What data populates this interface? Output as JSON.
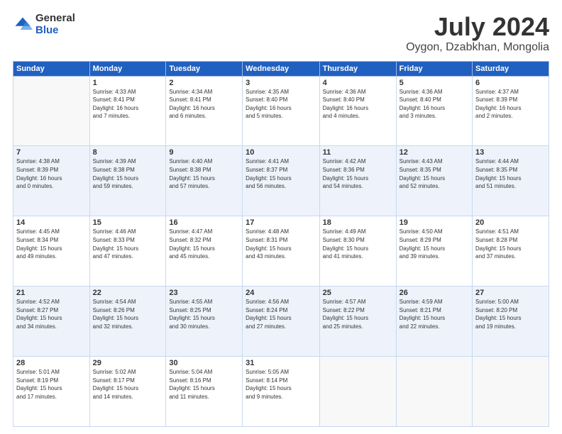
{
  "logo": {
    "general": "General",
    "blue": "Blue"
  },
  "header": {
    "month": "July 2024",
    "location": "Oygon, Dzabkhan, Mongolia"
  },
  "weekdays": [
    "Sunday",
    "Monday",
    "Tuesday",
    "Wednesday",
    "Thursday",
    "Friday",
    "Saturday"
  ],
  "weeks": [
    [
      {
        "day": "",
        "info": ""
      },
      {
        "day": "1",
        "info": "Sunrise: 4:33 AM\nSunset: 8:41 PM\nDaylight: 16 hours\nand 7 minutes."
      },
      {
        "day": "2",
        "info": "Sunrise: 4:34 AM\nSunset: 8:41 PM\nDaylight: 16 hours\nand 6 minutes."
      },
      {
        "day": "3",
        "info": "Sunrise: 4:35 AM\nSunset: 8:40 PM\nDaylight: 16 hours\nand 5 minutes."
      },
      {
        "day": "4",
        "info": "Sunrise: 4:36 AM\nSunset: 8:40 PM\nDaylight: 16 hours\nand 4 minutes."
      },
      {
        "day": "5",
        "info": "Sunrise: 4:36 AM\nSunset: 8:40 PM\nDaylight: 16 hours\nand 3 minutes."
      },
      {
        "day": "6",
        "info": "Sunrise: 4:37 AM\nSunset: 8:39 PM\nDaylight: 16 hours\nand 2 minutes."
      }
    ],
    [
      {
        "day": "7",
        "info": "Sunrise: 4:38 AM\nSunset: 8:39 PM\nDaylight: 16 hours\nand 0 minutes."
      },
      {
        "day": "8",
        "info": "Sunrise: 4:39 AM\nSunset: 8:38 PM\nDaylight: 15 hours\nand 59 minutes."
      },
      {
        "day": "9",
        "info": "Sunrise: 4:40 AM\nSunset: 8:38 PM\nDaylight: 15 hours\nand 57 minutes."
      },
      {
        "day": "10",
        "info": "Sunrise: 4:41 AM\nSunset: 8:37 PM\nDaylight: 15 hours\nand 56 minutes."
      },
      {
        "day": "11",
        "info": "Sunrise: 4:42 AM\nSunset: 8:36 PM\nDaylight: 15 hours\nand 54 minutes."
      },
      {
        "day": "12",
        "info": "Sunrise: 4:43 AM\nSunset: 8:35 PM\nDaylight: 15 hours\nand 52 minutes."
      },
      {
        "day": "13",
        "info": "Sunrise: 4:44 AM\nSunset: 8:35 PM\nDaylight: 15 hours\nand 51 minutes."
      }
    ],
    [
      {
        "day": "14",
        "info": "Sunrise: 4:45 AM\nSunset: 8:34 PM\nDaylight: 15 hours\nand 49 minutes."
      },
      {
        "day": "15",
        "info": "Sunrise: 4:46 AM\nSunset: 8:33 PM\nDaylight: 15 hours\nand 47 minutes."
      },
      {
        "day": "16",
        "info": "Sunrise: 4:47 AM\nSunset: 8:32 PM\nDaylight: 15 hours\nand 45 minutes."
      },
      {
        "day": "17",
        "info": "Sunrise: 4:48 AM\nSunset: 8:31 PM\nDaylight: 15 hours\nand 43 minutes."
      },
      {
        "day": "18",
        "info": "Sunrise: 4:49 AM\nSunset: 8:30 PM\nDaylight: 15 hours\nand 41 minutes."
      },
      {
        "day": "19",
        "info": "Sunrise: 4:50 AM\nSunset: 8:29 PM\nDaylight: 15 hours\nand 39 minutes."
      },
      {
        "day": "20",
        "info": "Sunrise: 4:51 AM\nSunset: 8:28 PM\nDaylight: 15 hours\nand 37 minutes."
      }
    ],
    [
      {
        "day": "21",
        "info": "Sunrise: 4:52 AM\nSunset: 8:27 PM\nDaylight: 15 hours\nand 34 minutes."
      },
      {
        "day": "22",
        "info": "Sunrise: 4:54 AM\nSunset: 8:26 PM\nDaylight: 15 hours\nand 32 minutes."
      },
      {
        "day": "23",
        "info": "Sunrise: 4:55 AM\nSunset: 8:25 PM\nDaylight: 15 hours\nand 30 minutes."
      },
      {
        "day": "24",
        "info": "Sunrise: 4:56 AM\nSunset: 8:24 PM\nDaylight: 15 hours\nand 27 minutes."
      },
      {
        "day": "25",
        "info": "Sunrise: 4:57 AM\nSunset: 8:22 PM\nDaylight: 15 hours\nand 25 minutes."
      },
      {
        "day": "26",
        "info": "Sunrise: 4:59 AM\nSunset: 8:21 PM\nDaylight: 15 hours\nand 22 minutes."
      },
      {
        "day": "27",
        "info": "Sunrise: 5:00 AM\nSunset: 8:20 PM\nDaylight: 15 hours\nand 19 minutes."
      }
    ],
    [
      {
        "day": "28",
        "info": "Sunrise: 5:01 AM\nSunset: 8:19 PM\nDaylight: 15 hours\nand 17 minutes."
      },
      {
        "day": "29",
        "info": "Sunrise: 5:02 AM\nSunset: 8:17 PM\nDaylight: 15 hours\nand 14 minutes."
      },
      {
        "day": "30",
        "info": "Sunrise: 5:04 AM\nSunset: 8:16 PM\nDaylight: 15 hours\nand 11 minutes."
      },
      {
        "day": "31",
        "info": "Sunrise: 5:05 AM\nSunset: 8:14 PM\nDaylight: 15 hours\nand 9 minutes."
      },
      {
        "day": "",
        "info": ""
      },
      {
        "day": "",
        "info": ""
      },
      {
        "day": "",
        "info": ""
      }
    ]
  ]
}
